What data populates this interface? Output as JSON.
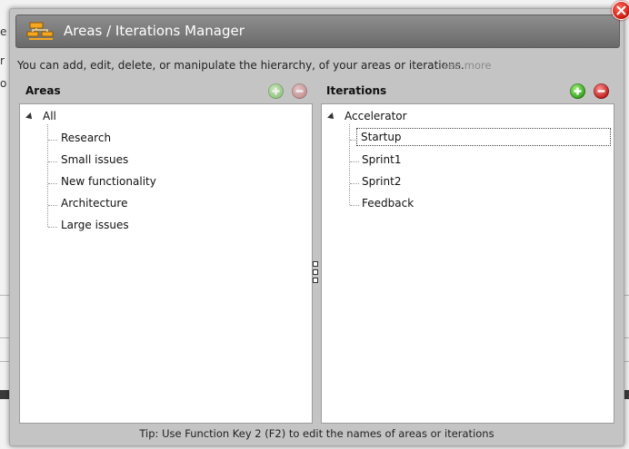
{
  "background": {
    "fragments": [
      "e",
      "r",
      "o"
    ]
  },
  "dialog": {
    "title": "Areas / Iterations Manager",
    "description": "You can add, edit, delete, or manipulate the hierarchy, of your areas or iterations.",
    "see_more": "see more",
    "tip": "Tip: Use Function Key 2 (F2) to edit the names of areas or iterations"
  },
  "areas": {
    "heading": "Areas",
    "add_enabled": false,
    "delete_enabled": false,
    "root": "All",
    "children": [
      "Research",
      "Small issues",
      "New functionality",
      "Architecture",
      "Large issues"
    ]
  },
  "iterations": {
    "heading": "Iterations",
    "add_enabled": true,
    "delete_enabled": true,
    "root": "Accelerator",
    "children": [
      "Startup",
      "Sprint1",
      "Sprint2",
      "Feedback"
    ],
    "selected": "Startup"
  },
  "colors": {
    "add": "#2f9a18",
    "delete": "#b81414",
    "close": "#c8180c",
    "title_bar": "#7a7a7a"
  }
}
